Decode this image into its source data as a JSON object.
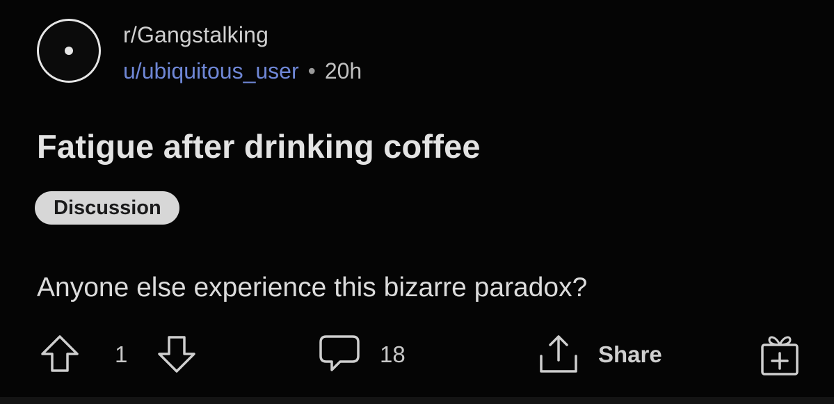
{
  "post": {
    "subreddit": "r/Gangstalking",
    "username": "u/ubiquitous_user",
    "separator": "•",
    "age": "20h",
    "title": "Fatigue after drinking coffee",
    "flair": "Discussion",
    "body": "Anyone else experience this bizarre paradox?"
  },
  "actions": {
    "score": "1",
    "comments": "18",
    "share_label": "Share"
  },
  "icons": {
    "avatar": "avatar-icon",
    "upvote": "upvote-arrow-icon",
    "downvote": "downvote-arrow-icon",
    "comment": "comment-bubble-icon",
    "share": "share-upload-icon",
    "award": "gift-award-icon"
  },
  "colors": {
    "background": "#050505",
    "username": "#6f87d6",
    "flair_bg": "#d7d7d7",
    "text": "#d7dadc"
  }
}
